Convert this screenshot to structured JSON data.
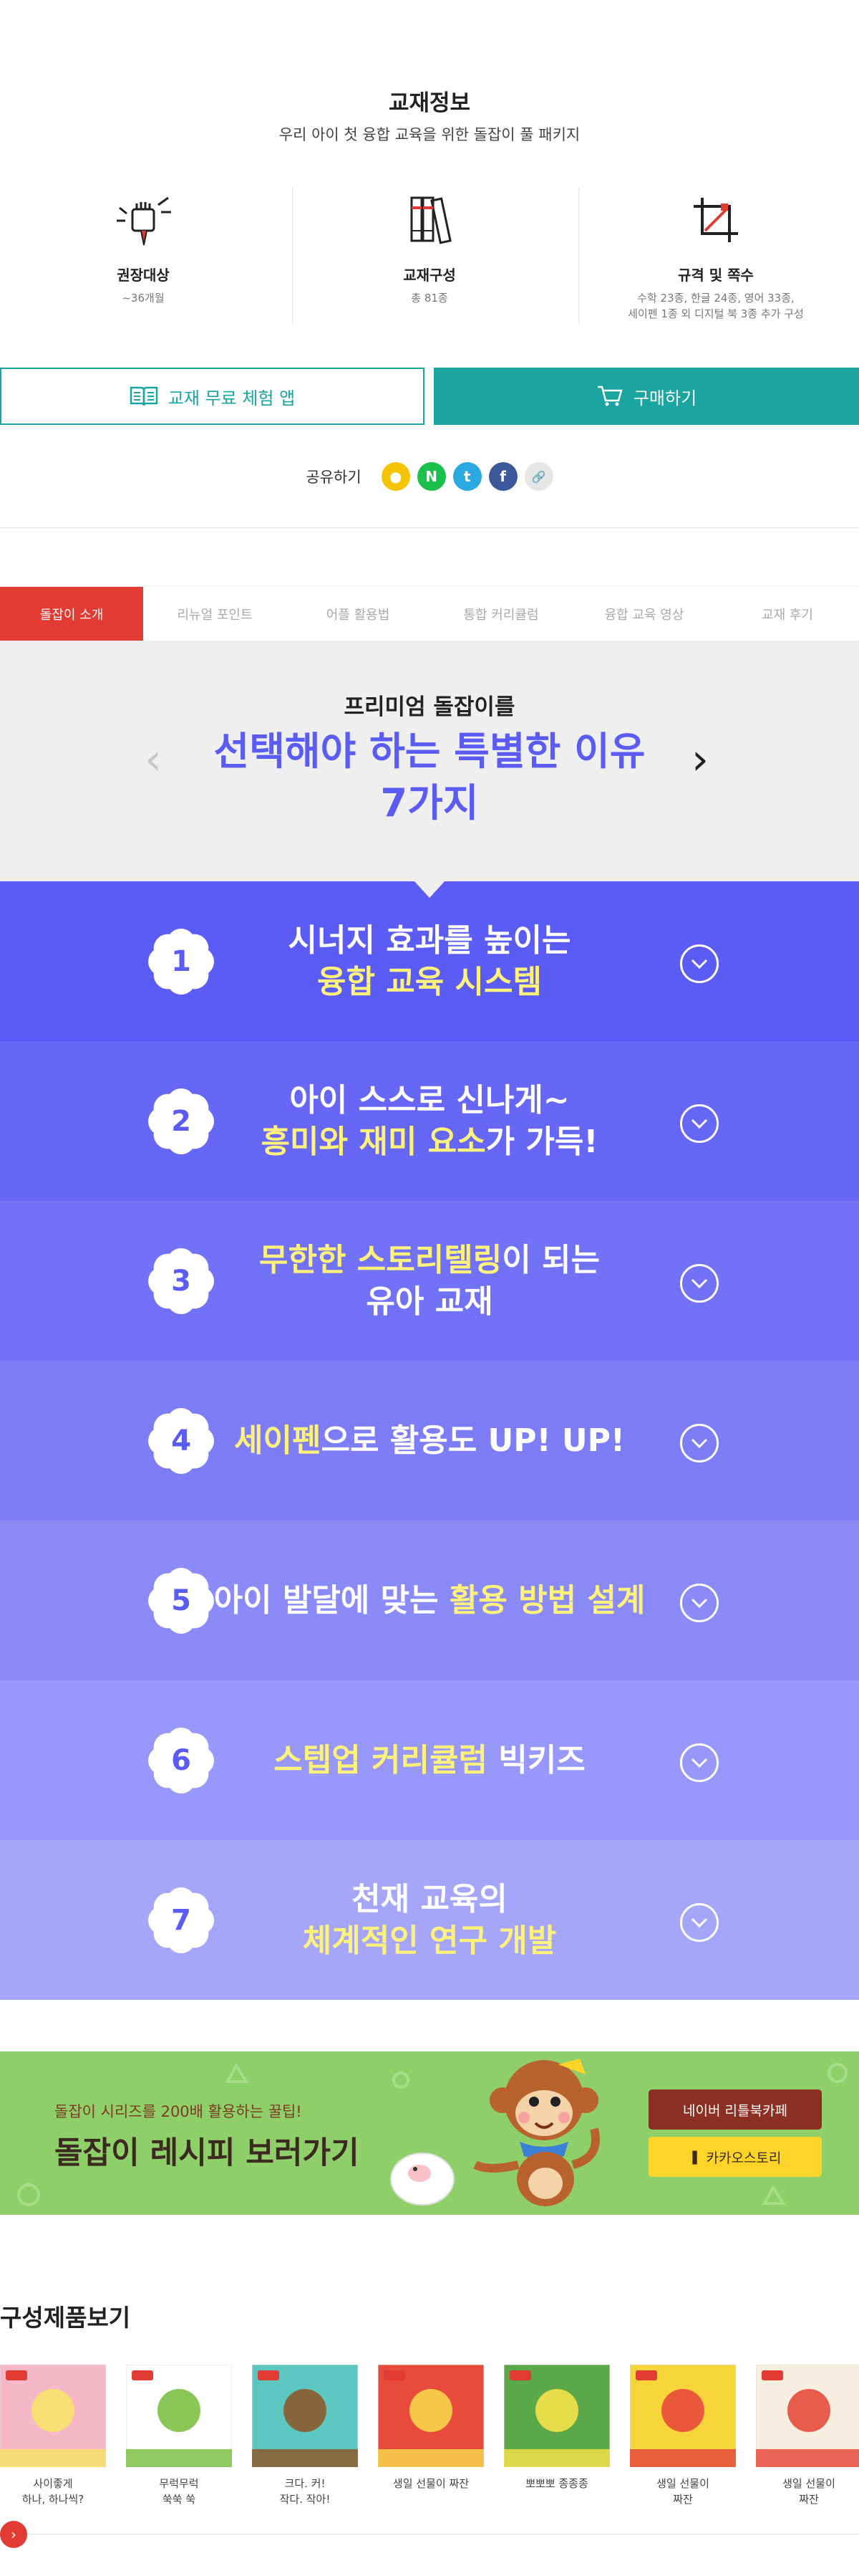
{
  "info": {
    "title": "교재정보",
    "subtitle": "우리 아이 첫 융합 교육을 위한 돌잡이 풀 패키지",
    "specs": [
      {
        "icon": "pen-fist-icon",
        "label": "권장대상",
        "value": "~36개월",
        "value2": ""
      },
      {
        "icon": "books-icon",
        "label": "교재구성",
        "value": "총 81종",
        "value2": ""
      },
      {
        "icon": "crop-size-icon",
        "label": "규격 및 쪽수",
        "value": "수학 23종, 한글 24종, 영어 33종,",
        "value2": "세이펜 1종 외 디지털 북 3종 추가 구성"
      }
    ]
  },
  "actions": {
    "app_label": "교재 무료 체험 앱",
    "buy_label": "구매하기"
  },
  "share": {
    "label": "공유하기",
    "icons": [
      {
        "name": "kakaotalk-icon",
        "glyph": "●",
        "color": "#f5c400"
      },
      {
        "name": "naver-icon",
        "glyph": "N",
        "color": "#19c14a"
      },
      {
        "name": "twitter-icon",
        "glyph": "t",
        "color": "#2aa8e0"
      },
      {
        "name": "facebook-icon",
        "glyph": "f",
        "color": "#3b5998"
      },
      {
        "name": "link-icon",
        "glyph": "🔗",
        "color": "#e6e6e6"
      }
    ]
  },
  "tabs": [
    "돌잡이 소개",
    "리뉴얼 포인트",
    "어플 활용법",
    "통합 커리큘럼",
    "융합 교육 영상",
    "교재 후기"
  ],
  "premium": {
    "small": "프리미엄 돌잡이를",
    "big_line1": "선택해야 하는 특별한 이유",
    "big_line2": "7가지"
  },
  "reasons": [
    {
      "num": "1",
      "color": "#5b5cf5",
      "lines": [
        [
          {
            "t": "시너지 효과를 높이는",
            "y": false
          }
        ],
        [
          {
            "t": "융합 교육 시스템",
            "y": true
          }
        ]
      ]
    },
    {
      "num": "2",
      "color": "#6667f6",
      "lines": [
        [
          {
            "t": "아이 스스로 신나게~",
            "y": false
          }
        ],
        [
          {
            "t": "흥미와 재미 요소",
            "y": true
          },
          {
            "t": "가 가득!",
            "y": false
          }
        ]
      ]
    },
    {
      "num": "3",
      "color": "#7172f7",
      "lines": [
        [
          {
            "t": "무한한 스토리텔링",
            "y": true
          },
          {
            "t": "이 되는",
            "y": false
          }
        ],
        [
          {
            "t": "유아 교재",
            "y": false
          }
        ]
      ]
    },
    {
      "num": "4",
      "color": "#7d7ef7",
      "lines": [
        [
          {
            "t": "세이펜",
            "y": true
          },
          {
            "t": "으로 활용도 UP! UP!",
            "y": false
          }
        ]
      ]
    },
    {
      "num": "5",
      "color": "#8a8bf8",
      "lines": [
        [
          {
            "t": "아이 발달에 맞는 ",
            "y": false
          },
          {
            "t": "활용 방법 설계",
            "y": true
          }
        ]
      ]
    },
    {
      "num": "6",
      "color": "#9798f9",
      "lines": [
        [
          {
            "t": "스텝업 커리큘럼 ",
            "y": true
          },
          {
            "t": "빅키즈",
            "y": false
          }
        ]
      ]
    },
    {
      "num": "7",
      "color": "#a5a6fa",
      "lines": [
        [
          {
            "t": "천재 교육의",
            "y": false
          }
        ],
        [
          {
            "t": "체계적인 연구 개발",
            "y": true
          }
        ]
      ]
    }
  ],
  "banner": {
    "subtitle": "돌잡이 시리즈를 200배 활용하는 꿀팁!",
    "title": "돌잡이 레시피 보러가기",
    "naver_label": "네이버 리틀북카페",
    "kakao_label": "카카오스토리"
  },
  "products": {
    "title": "구성제품보기",
    "items": [
      {
        "name1": "사이좋게",
        "name2": "하나, 하나씩?",
        "cover": "#f6b7c6",
        "accent": "#f7e26b"
      },
      {
        "name1": "무럭무럭",
        "name2": "쑥쑥 쑥",
        "cover": "#ffffff",
        "accent": "#7bc043"
      },
      {
        "name1": "크다. 커!",
        "name2": "작다. 작아!",
        "cover": "#5cc7c0",
        "accent": "#8b5a2b"
      },
      {
        "name1": "생일 선물이 짜잔",
        "name2": "",
        "cover": "#e84a3c",
        "accent": "#f7d34a"
      },
      {
        "name1": "뽀뽀뽀 종종종",
        "name2": "",
        "cover": "#5aa84a",
        "accent": "#f5e14a"
      },
      {
        "name1": "생일 선물이",
        "name2": "짜잔",
        "cover": "#f7d43a",
        "accent": "#e84a3c"
      },
      {
        "name1": "생일 선물이",
        "name2": "짜잔",
        "cover": "#f6efe0",
        "accent": "#e84a3c"
      }
    ]
  },
  "colors": {
    "teal": "#1aa5a0",
    "red": "#e13b34",
    "purple": "#5b5cf5",
    "yellow_text": "#fff27a",
    "banner_green": "#8fcf6a"
  }
}
